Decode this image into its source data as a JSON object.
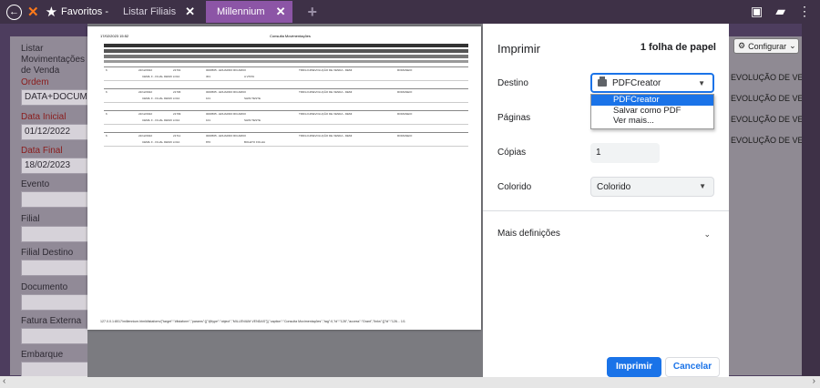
{
  "topbar": {
    "favorites_label": "Favoritos -",
    "tabs": [
      {
        "label": "Listar Filiais"
      },
      {
        "label": "Millennium"
      }
    ]
  },
  "left_panel": {
    "title": "Listar Movimentações de Venda",
    "ordem_label": "Ordem",
    "ordem_value": "DATA+DOCUMENTO",
    "data_inicial_label": "Data Inicial",
    "data_inicial_value": "01/12/2022",
    "data_final_label": "Data Final",
    "data_final_value": "18/02/2023",
    "evento_label": "Evento",
    "filial_label": "Filial",
    "filial_destino_label": "Filial Destino",
    "documento_label": "Documento",
    "fatura_externa_label": "Fatura Externa",
    "embarque_label": "Embarque"
  },
  "right_panel": {
    "configurar_label": "Configurar",
    "rows": [
      "EVOLUÇÃO DE VENDA",
      "EVOLUÇÃO DE VENDA",
      "EVOLUÇÃO DE VENDA",
      "EVOLUÇÃO DE VENDA"
    ]
  },
  "preview": {
    "date": "17/02/2023 15:52",
    "title": "Consulta Movimentações",
    "footer": "127.0.0.1:8017/millennium.html#listaform/{\"target\":\"#listaform\",\"params\":[{\"@type\":\"object\",\"MILLENIUM VENDAS\"}],\"caption\":\"Consulta Movimentações\",\"tag\":0,\"id\":\"126\",\"access\":\"Grant\",\"links\":[{\"id\":\"126...   1/1",
    "records": [
      {
        "num": "6",
        "data": "22/12/2022",
        "doc": "21701",
        "evento": "0000565 - EDUARDO RICARDO",
        "filial": "CEMIL F - FILIAL DEMO LOJA",
        "cod": "301",
        "nome": "A VISTA",
        "op": "TRD/LOJ/DEVOLUÇÃO DE VENDA - DEMI",
        "tipo": "ROMANEIO"
      },
      {
        "num": "6",
        "data": "22/12/2022",
        "doc": "21706",
        "evento": "0000565 - EDUARDO RICARDO",
        "filial": "CEMIL F - FILIAL DEMO LOJA",
        "cod": "101",
        "nome": "SHIM TESTE",
        "op": "TRD/LOJ/DEVOLUÇÃO DE VENDA - DEMI",
        "tipo": "ROMANEIO"
      },
      {
        "num": "6",
        "data": "22/12/2022",
        "doc": "21709",
        "evento": "0000565 - EDUARDO RICARDO",
        "filial": "CEMIL F - FILIAL DEMO LOJA",
        "cod": "101",
        "nome": "SHIM TESTE",
        "op": "TRD/LOJ/DEVOLUÇÃO DE VENDA - DEMI",
        "tipo": "ROMANEIO"
      },
      {
        "num": "6",
        "data": "22/12/2022",
        "doc": "21711",
        "evento": "0000565 - EDUARDO RICARDO",
        "filial": "CEMIL F - FILIAL DEMO LOJA",
        "cod": "870",
        "nome": "BOLETO FOLHA",
        "op": "TRD/LOJ/DEVOLUÇÃO DE VENDA - DEMI",
        "tipo": "ROMANEIO"
      }
    ]
  },
  "dialog": {
    "title": "Imprimir",
    "sheet_count": "1 folha de papel",
    "destino_label": "Destino",
    "destino_value": "PDFCreator",
    "dest_options": [
      "PDFCreator",
      "Salvar como PDF",
      "Ver mais..."
    ],
    "paginas_label": "Páginas",
    "copias_label": "Cópias",
    "copias_value": "1",
    "colorido_label": "Colorido",
    "colorido_value": "Colorido",
    "mais_label": "Mais definições",
    "print_label": "Imprimir",
    "cancel_label": "Cancelar"
  }
}
